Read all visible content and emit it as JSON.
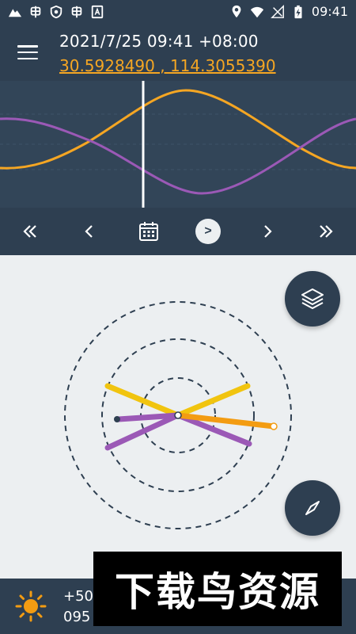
{
  "status_bar": {
    "time": "09:41",
    "left_icons": [
      "mountain-icon",
      "bug-icon",
      "shield-icon",
      "bug-icon",
      "a-box-icon"
    ],
    "right_icons": [
      "location-pin-icon",
      "wifi-icon",
      "signal-icon",
      "battery-charging-icon"
    ]
  },
  "header": {
    "menu_icon": "hamburger-menu-icon",
    "datetime": "2021/7/25 09:41 +08:00",
    "coordinates": "30.5928490 , 114.3055390"
  },
  "graph": {
    "colors": {
      "sun": "#f5a623",
      "moon": "#9b59b6",
      "background": "#324558",
      "cursor": "#ffffff"
    }
  },
  "time_nav": {
    "buttons": [
      {
        "name": "fast-rewind-button",
        "icon": "double-chevron-left-icon"
      },
      {
        "name": "step-back-button",
        "icon": "chevron-left-icon"
      },
      {
        "name": "calendar-button",
        "icon": "calendar-icon"
      },
      {
        "name": "play-button",
        "icon": "play-icon",
        "label": ">"
      },
      {
        "name": "step-forward-button",
        "icon": "chevron-right-icon"
      },
      {
        "name": "fast-forward-button",
        "icon": "double-chevron-right-icon"
      }
    ]
  },
  "map": {
    "fab_layers_icon": "layers-icon",
    "fab_compass_icon": "compass-icon",
    "colors": {
      "sun_yellow": "#f1c40f",
      "sun_orange": "#f39c12",
      "moon_purple": "#9b59b6",
      "ring": "#2e3f51"
    }
  },
  "bottom": {
    "icon": "sun-icon",
    "line1": "+50",
    "line2": "095"
  },
  "watermark": {
    "text": "下载鸟资源"
  }
}
